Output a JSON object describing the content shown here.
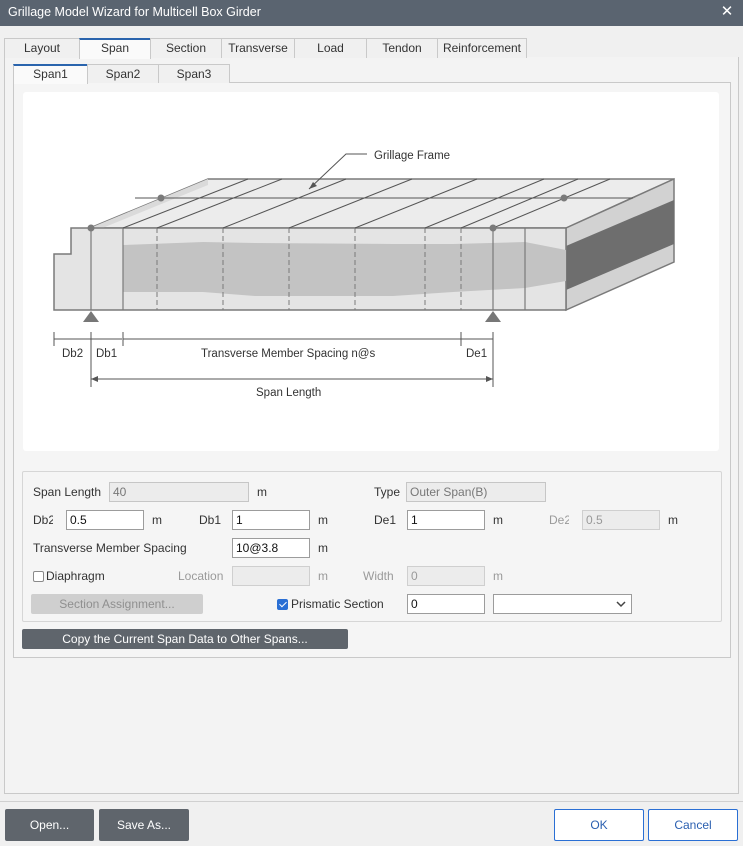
{
  "window": {
    "title": "Grillage Model Wizard for Multicell Box Girder",
    "close_glyph": "✕"
  },
  "main_tabs": [
    {
      "label": "Layout"
    },
    {
      "label": "Span"
    },
    {
      "label": "Section"
    },
    {
      "label": "Transverse"
    },
    {
      "label": "Load"
    },
    {
      "label": "Tendon"
    },
    {
      "label": "Reinforcement"
    }
  ],
  "active_main_tab": "Span",
  "span_tabs": [
    {
      "label": "Span1"
    },
    {
      "label": "Span2"
    },
    {
      "label": "Span3"
    }
  ],
  "active_span_tab": "Span1",
  "diagram": {
    "frame_label": "Grillage Frame",
    "db2": "Db2",
    "db1": "Db1",
    "spacing": "Transverse Member Spacing n@s",
    "de1": "De1",
    "span_length": "Span Length"
  },
  "form": {
    "span_length": {
      "label": "Span Length",
      "value": "40",
      "unit": "m"
    },
    "type": {
      "label": "Type",
      "value": "Outer Span(B)"
    },
    "db2": {
      "label": "Db2",
      "value": "0.5",
      "unit": "m"
    },
    "db1": {
      "label": "Db1",
      "value": "1",
      "unit": "m"
    },
    "de1": {
      "label": "De1",
      "value": "1",
      "unit": "m"
    },
    "de2": {
      "label": "De2",
      "value": "0.5",
      "unit": "m"
    },
    "spacing": {
      "label": "Transverse Member Spacing",
      "value": "10@3.8",
      "unit": "m"
    },
    "diaphragm": {
      "label": "Diaphragm",
      "checked": false
    },
    "location": {
      "label": "Location",
      "value": "",
      "unit": "m"
    },
    "width": {
      "label": "Width",
      "value": "0",
      "unit": "m"
    },
    "section_assignment": {
      "label": "Section Assignment..."
    },
    "prismatic": {
      "label": "Prismatic Section",
      "checked": true,
      "value": "0",
      "select_value": ""
    }
  },
  "copy_button": "Copy the Current Span Data to Other Spans...",
  "footer": {
    "open": "Open...",
    "save_as": "Save As...",
    "ok": "OK",
    "cancel": "Cancel"
  },
  "colors": {
    "titlebar": "#5a6470",
    "accent": "#2a6fd4",
    "dark_button": "#5f656c"
  }
}
